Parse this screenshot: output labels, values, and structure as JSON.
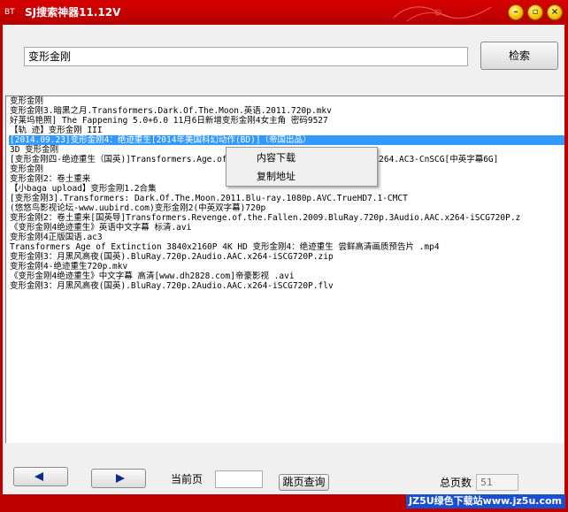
{
  "window": {
    "title": "SJ搜索神器11.12V",
    "logo_text": "BT",
    "accent_color": "#c00000"
  },
  "search": {
    "value": "变形金刚",
    "button_label": "检索"
  },
  "results": [
    "变形金刚",
    "变形金刚3.暗黑之月.Transformers.Dark.Of.The.Moon.英语.2011.720p.mkv",
    "好莱坞艳照] The Fappening 5.0+6.0 11月6日新增变形金刚4女主角  密码9527",
    "【轨 迹】变形金刚 III",
    "[2014.09.23]变形金刚4：绝迹重生[2014年美国科幻动作(BD)]（帝国出品）",
    "3D 变形金刚",
    "[变形金刚四-绝迹重生（国英)]Transformers.Age.of.Extinction.2014.BluRay.720p.x264.AC3-CnSCG[中英字幕6G]",
    "变形金刚",
    "变形金刚2：卷土重来",
    "【小baga upload】变形金刚1.2合集",
    "[变形金刚3].Transformers: Dark.Of.The.Moon.2011.Blu-ray.1080p.AVC.TrueHD7.1-CMCT",
    "(悠悠鸟影视论坛-www.uubird.com)变形金刚2(中英双字幕)720p",
    "变形金刚2：卷土重来[国英导]Transformers.Revenge.of.the.Fallen.2009.BluRay.720p.3Audio.AAC.x264-iSCG720P.z",
    "《变形金刚4绝迹重生》英语中文字幕 标清.avi",
    "变形金刚4正版国语.ac3",
    "Transformers Age of Extinction  3840x2160P 4K HD 变形金刚4：绝迹重生 尝鲜高清画质预告片 .mp4",
    "变形金刚3：月黑风高夜(国英).BluRay.720p.2Audio.AAC.x264-iSCG720P.zip",
    "变形金刚4-绝迹重生720p.mkv",
    "《变形金刚4绝迹重生》中文字幕 高清[www.dh2828.com]帝豪影视  .avi",
    "变形金刚3：月黑风高夜(国英).BluRay.720p.2Audio.AAC.x264-iSCG720P.flv"
  ],
  "selected_index": 4,
  "context_menu": {
    "items": [
      "内容下载",
      "复制地址"
    ]
  },
  "pagination": {
    "current_page_label": "当前页",
    "current_page_value": "",
    "jump_button_label": "跳页查询",
    "total_pages_label": "总页数",
    "total_pages_value": "51",
    "prev_icon": "left-triangle-icon",
    "next_icon": "right-triangle-icon"
  },
  "watermark": {
    "text": "JZ5U绿色下载站www.jz5u.com"
  }
}
